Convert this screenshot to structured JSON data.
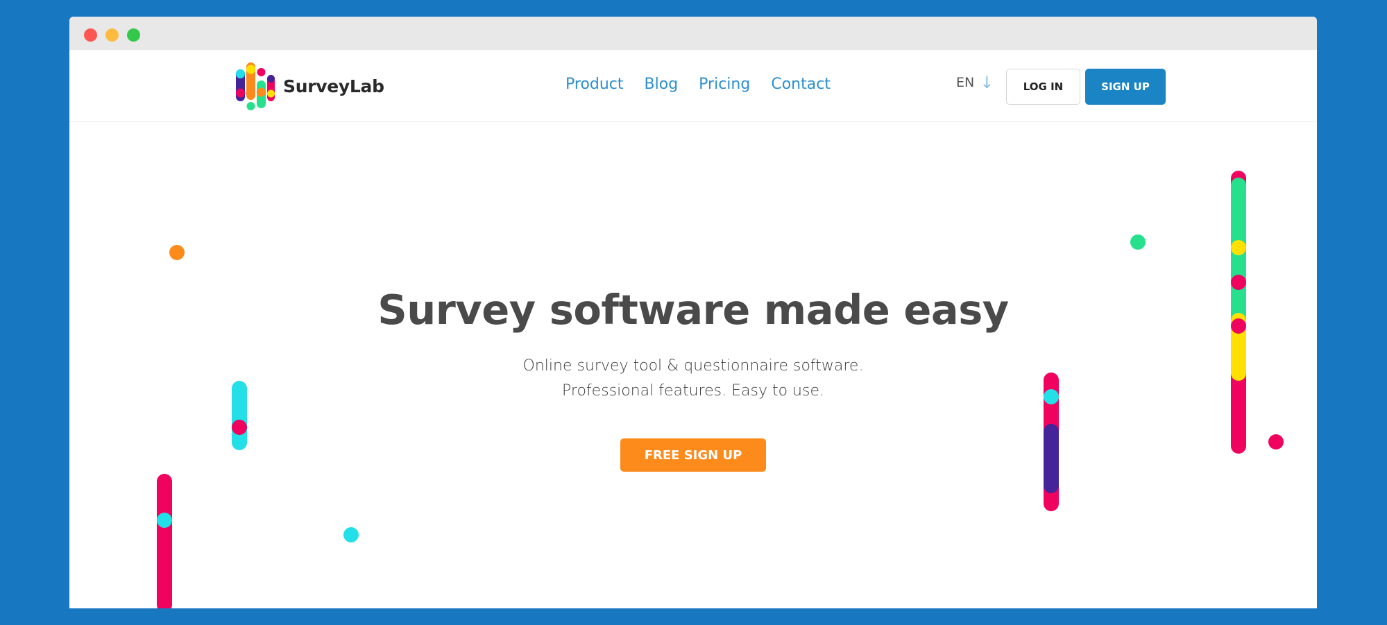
{
  "window": {
    "controls": [
      "close",
      "minimize",
      "maximize"
    ]
  },
  "header": {
    "logo_text": "SurveyLab",
    "nav": [
      {
        "label": "Product"
      },
      {
        "label": "Blog"
      },
      {
        "label": "Pricing"
      },
      {
        "label": "Contact"
      }
    ],
    "language": "EN",
    "language_icon": "arrow-down-icon",
    "login_label": "LOG IN",
    "signup_label": "SIGN UP"
  },
  "hero": {
    "headline": "Survey software made easy",
    "subtitle_line1": "Online survey tool & questionnaire software.",
    "subtitle_line2": "Professional features. Easy to use.",
    "cta_label": "FREE SIGN UP"
  },
  "colors": {
    "background": "#1877c1",
    "brand_blue": "#1a84c4",
    "link_blue": "#2d8fd0",
    "cta_orange": "#fd8b1c",
    "pink": "#f0035f",
    "cyan": "#22dfe8",
    "green": "#27e08d",
    "yellow": "#ffe000",
    "purple": "#45249a",
    "orange": "#fd8b1c"
  }
}
